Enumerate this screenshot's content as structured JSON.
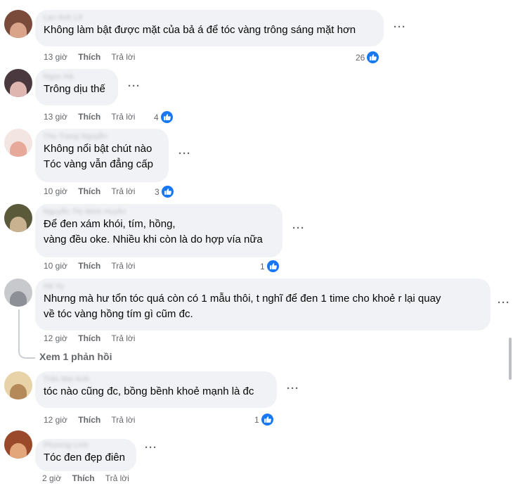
{
  "comments": [
    {
      "author": "Lan Anh Lê",
      "text_lines": [
        "Không làm bật được mặt của bả á để tóc vàng trông sáng mặt hơn"
      ],
      "time": "13 giờ",
      "like_label": "Thích",
      "reply_label": "Trả lời",
      "reactions": "26",
      "avatar_colors": [
        "#7a4a3a",
        "#d9a48a"
      ]
    },
    {
      "author": "Ngọc Hà",
      "text_lines": [
        "Trông dịu thế"
      ],
      "time": "13 giờ",
      "like_label": "Thích",
      "reply_label": "Trả lời",
      "reactions": "4",
      "avatar_colors": [
        "#4a3a3f",
        "#e0b7b0"
      ]
    },
    {
      "author": "Thu Trang Nguyễn",
      "text_lines": [
        "Không nổi bật chút nào",
        "Tóc vàng vẫn đẳng cấp"
      ],
      "time": "10 giờ",
      "like_label": "Thích",
      "reply_label": "Trả lời",
      "reactions": "3",
      "avatar_colors": [
        "#f3e6e2",
        "#e6a99a"
      ]
    },
    {
      "author": "Nguyễn Thị Minh Huyền",
      "text_lines": [
        "Để đen xám khói, tím, hồng,",
        "vàng đều oke. Nhiều khi còn là do hợp vía nữa"
      ],
      "time": "10 giờ",
      "like_label": "Thích",
      "reply_label": "Trả lời",
      "reactions": "1",
      "avatar_colors": [
        "#5a5a3a",
        "#c9b28f"
      ]
    },
    {
      "author": "Hà Vy",
      "text_lines": [
        "Nhưng mà hư tổn tóc quá còn có 1 mẫu thôi, t nghĩ để đen 1 time cho khoẻ r lại quay",
        "về tóc vàng hồng tím gì cũm đc."
      ],
      "time": "12 giờ",
      "like_label": "Thích",
      "reply_label": "Trả lời",
      "reactions": "",
      "avatar_colors": [
        "#c7c9cc",
        "#8d9096"
      ]
    },
    {
      "author": "Trần Mai Anh",
      "text_lines": [
        "tóc nào cũng đc, bồng bềnh khoẻ mạnh là đc"
      ],
      "time": "12 giờ",
      "like_label": "Thích",
      "reply_label": "Trả lời",
      "reactions": "1",
      "avatar_colors": [
        "#e8d3a8",
        "#b48a5a"
      ]
    },
    {
      "author": "Phương Linh",
      "text_lines": [
        "Tóc đen đẹp điên"
      ],
      "time": "2 giờ",
      "like_label": "Thích",
      "reply_label": "Trả lời",
      "reactions": "",
      "avatar_colors": [
        "#9a4a2a",
        "#e3a57a"
      ]
    }
  ],
  "view_replies": "Xem 1 phản hồi",
  "more_label": "···",
  "colors": {
    "bubble": "#f0f2f5",
    "meta": "#65676b",
    "like_blue": "#1877f2"
  }
}
